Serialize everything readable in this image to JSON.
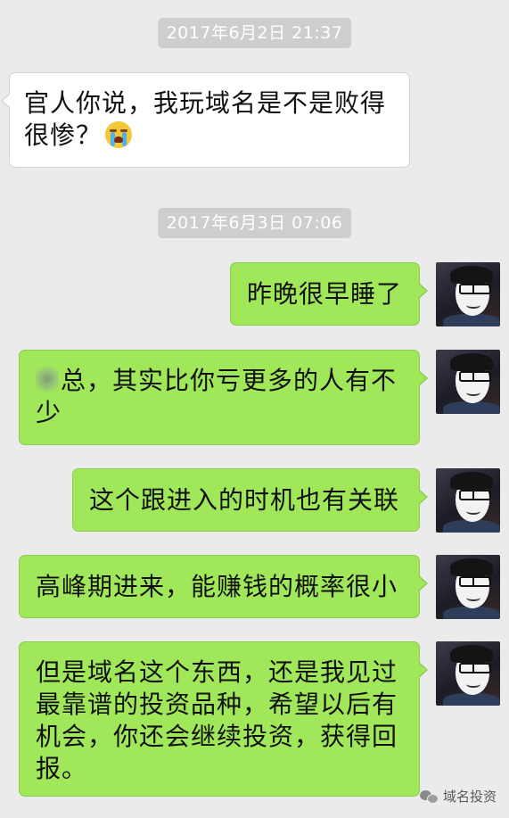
{
  "timestamps": [
    "2017年6月2日 21:37",
    "2017年6月3日 07:06"
  ],
  "messages": [
    {
      "side": "left",
      "text": "官人你说，我玩域名是不是败得很惨？"
    },
    {
      "side": "right",
      "text": "昨晚很早睡了"
    },
    {
      "side": "right",
      "text": "总，其实比你亏更多的人有不少"
    },
    {
      "side": "right",
      "text": "这个跟进入的时机也有关联"
    },
    {
      "side": "right",
      "text": "高峰期进来，能赚钱的概率很小"
    },
    {
      "side": "right",
      "text": "但是域名这个东西，还是我见过最靠谱的投资品种，希望以后有机会，你还会继续投资，获得回报。"
    }
  ],
  "icons": {
    "emoji": "crying-face-icon",
    "avatar": "user-avatar",
    "watermark": "wechat-icon"
  },
  "colors": {
    "background": "#ebebeb",
    "right_bubble": "#a0e75a",
    "left_bubble": "#ffffff",
    "timestamp_bg": "#cecece"
  },
  "watermark": {
    "text": "域名投资"
  }
}
